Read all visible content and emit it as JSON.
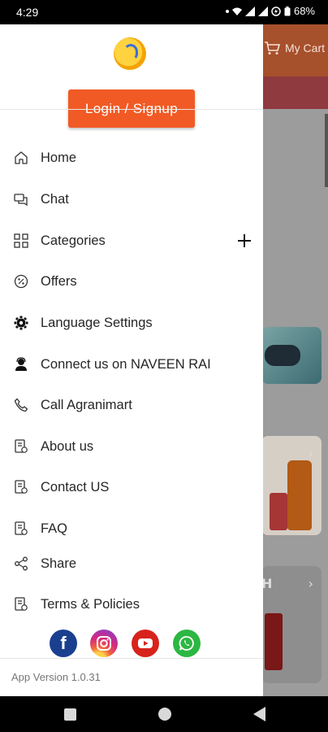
{
  "status_bar": {
    "time": "4:29",
    "battery": "68%",
    "icons": [
      "notification-dot-icon",
      "wifi-icon",
      "signal-icon",
      "signal-icon",
      "data-saver-icon",
      "battery-icon"
    ]
  },
  "background_app": {
    "cart_label": "My Cart",
    "header_color": "#a7502c"
  },
  "drawer": {
    "login_label": "Login / Signup",
    "menu": [
      {
        "label": "Home",
        "icon": "home-icon"
      },
      {
        "label": "Chat",
        "icon": "chat-icon"
      },
      {
        "label": "Categories",
        "icon": "grid-icon",
        "expand": "plus-icon"
      },
      {
        "label": "Offers",
        "icon": "percent-icon"
      },
      {
        "label": "Language Settings",
        "icon": "gear-icon"
      },
      {
        "label": "Connect us on NAVEEN RAI",
        "icon": "agent-icon"
      },
      {
        "label": "Call Agranimart",
        "icon": "phone-icon"
      },
      {
        "label": "About us",
        "icon": "document-icon"
      },
      {
        "label": "Contact US",
        "icon": "document-icon"
      },
      {
        "label": "FAQ",
        "icon": "document-icon"
      },
      {
        "label": "Share",
        "icon": "share-icon"
      },
      {
        "label": "Terms & Policies",
        "icon": "document-icon"
      }
    ],
    "social": [
      {
        "name": "facebook-icon",
        "glyph": "f"
      },
      {
        "name": "instagram-icon",
        "glyph": ""
      },
      {
        "name": "youtube-icon",
        "glyph": ""
      },
      {
        "name": "whatsapp-icon",
        "glyph": ""
      }
    ],
    "app_version": "App Version 1.0.31"
  },
  "colors": {
    "accent": "#f15a24",
    "drawer_bg": "#ffffff",
    "text": "#262626"
  }
}
